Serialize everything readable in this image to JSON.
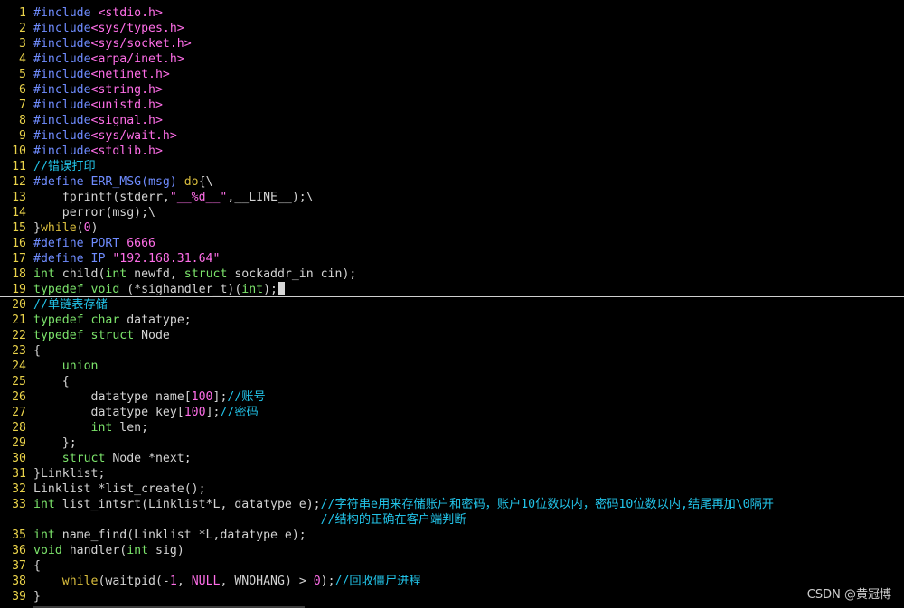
{
  "colors": {
    "keyword": "#d9bd3d",
    "preproc": "#6f8cff",
    "string": "#ff6ee8",
    "number": "#ff6ee8",
    "comment": "#22c3e8",
    "type": "#7ce46b",
    "text": "#d3d3d3",
    "linenum": "#e9d24a"
  },
  "lines": [
    {
      "n": "1",
      "tokens": [
        [
          "preproc",
          "#include "
        ],
        [
          "string",
          "<stdio.h>"
        ]
      ]
    },
    {
      "n": "2",
      "tokens": [
        [
          "preproc",
          "#include"
        ],
        [
          "string",
          "<sys/types.h>"
        ]
      ]
    },
    {
      "n": "3",
      "tokens": [
        [
          "preproc",
          "#include"
        ],
        [
          "string",
          "<sys/socket.h>"
        ]
      ]
    },
    {
      "n": "4",
      "tokens": [
        [
          "preproc",
          "#include"
        ],
        [
          "string",
          "<arpa/inet.h>"
        ]
      ]
    },
    {
      "n": "5",
      "tokens": [
        [
          "preproc",
          "#include"
        ],
        [
          "string",
          "<netinet.h>"
        ]
      ]
    },
    {
      "n": "6",
      "tokens": [
        [
          "preproc",
          "#include"
        ],
        [
          "string",
          "<string.h>"
        ]
      ]
    },
    {
      "n": "7",
      "tokens": [
        [
          "preproc",
          "#include"
        ],
        [
          "string",
          "<unistd.h>"
        ]
      ]
    },
    {
      "n": "8",
      "tokens": [
        [
          "preproc",
          "#include"
        ],
        [
          "string",
          "<signal.h>"
        ]
      ]
    },
    {
      "n": "9",
      "tokens": [
        [
          "preproc",
          "#include"
        ],
        [
          "string",
          "<sys/wait.h>"
        ]
      ]
    },
    {
      "n": "10",
      "tokens": [
        [
          "preproc",
          "#include"
        ],
        [
          "string",
          "<stdlib.h>"
        ]
      ]
    },
    {
      "n": "11",
      "tokens": [
        [
          "comment",
          "//错误打印"
        ]
      ]
    },
    {
      "n": "12",
      "tokens": [
        [
          "preproc",
          "#define ERR_MSG(msg) "
        ],
        [
          "keyword",
          "do"
        ],
        [
          "text",
          "{\\"
        ]
      ]
    },
    {
      "n": "13",
      "tokens": [
        [
          "text",
          "    fprintf(stderr,"
        ],
        [
          "string",
          "\"__%d__\""
        ],
        [
          "text",
          ",__LINE__);\\"
        ]
      ]
    },
    {
      "n": "14",
      "tokens": [
        [
          "text",
          "    perror(msg);\\"
        ]
      ]
    },
    {
      "n": "15",
      "tokens": [
        [
          "text",
          "}"
        ],
        [
          "keyword",
          "while"
        ],
        [
          "text",
          "("
        ],
        [
          "number",
          "0"
        ],
        [
          "text",
          ")"
        ]
      ]
    },
    {
      "n": "16",
      "tokens": [
        [
          "preproc",
          "#define PORT "
        ],
        [
          "number",
          "6666"
        ]
      ]
    },
    {
      "n": "17",
      "tokens": [
        [
          "preproc",
          "#define IP "
        ],
        [
          "string",
          "\"192.168.31.64\""
        ]
      ]
    },
    {
      "n": "18",
      "tokens": [
        [
          "type",
          "int"
        ],
        [
          "text",
          " child("
        ],
        [
          "type",
          "int"
        ],
        [
          "text",
          " newfd, "
        ],
        [
          "type",
          "struct"
        ],
        [
          "text",
          " sockaddr_in cin);"
        ]
      ]
    },
    {
      "n": "19",
      "cursorline": true,
      "tokens": [
        [
          "type",
          "typedef"
        ],
        [
          "text",
          " "
        ],
        [
          "type",
          "void"
        ],
        [
          "text",
          " (*sighandler_t)("
        ],
        [
          "type",
          "int"
        ],
        [
          "text",
          ");"
        ]
      ]
    },
    {
      "n": "20",
      "tokens": [
        [
          "comment",
          "//单链表存储"
        ]
      ]
    },
    {
      "n": "21",
      "tokens": [
        [
          "type",
          "typedef"
        ],
        [
          "text",
          " "
        ],
        [
          "type",
          "char"
        ],
        [
          "text",
          " datatype;"
        ]
      ]
    },
    {
      "n": "22",
      "tokens": [
        [
          "type",
          "typedef"
        ],
        [
          "text",
          " "
        ],
        [
          "type",
          "struct"
        ],
        [
          "text",
          " Node"
        ]
      ]
    },
    {
      "n": "23",
      "tokens": [
        [
          "text",
          "{"
        ]
      ]
    },
    {
      "n": "24",
      "tokens": [
        [
          "text",
          "    "
        ],
        [
          "type",
          "union"
        ]
      ]
    },
    {
      "n": "25",
      "tokens": [
        [
          "text",
          "    {"
        ]
      ]
    },
    {
      "n": "26",
      "tokens": [
        [
          "text",
          "        datatype name["
        ],
        [
          "number",
          "100"
        ],
        [
          "text",
          "];"
        ],
        [
          "comment",
          "//账号"
        ]
      ]
    },
    {
      "n": "27",
      "tokens": [
        [
          "text",
          "        datatype key["
        ],
        [
          "number",
          "100"
        ],
        [
          "text",
          "];"
        ],
        [
          "comment",
          "//密码"
        ]
      ]
    },
    {
      "n": "28",
      "tokens": [
        [
          "text",
          "        "
        ],
        [
          "type",
          "int"
        ],
        [
          "text",
          " len;"
        ]
      ]
    },
    {
      "n": "29",
      "tokens": [
        [
          "text",
          "    };"
        ]
      ]
    },
    {
      "n": "30",
      "tokens": [
        [
          "text",
          "    "
        ],
        [
          "type",
          "struct"
        ],
        [
          "text",
          " Node *next;"
        ]
      ]
    },
    {
      "n": "31",
      "tokens": [
        [
          "text",
          "}Linklist;"
        ]
      ]
    },
    {
      "n": "32",
      "tokens": [
        [
          "text",
          "Linklist *list_create();"
        ]
      ]
    },
    {
      "n": "33",
      "tokens": [
        [
          "type",
          "int"
        ],
        [
          "text",
          " list_intsrt(Linklist*L, datatype e);"
        ],
        [
          "comment",
          "//字符串e用来存储账户和密码，账户10位数以内，密码10位数以内,结尾再加\\0隔开"
        ]
      ]
    },
    {
      "n": "",
      "tokens": [
        [
          "comment",
          "                                        //结构的正确在客户端判断"
        ]
      ]
    },
    {
      "n": "35",
      "tokens": [
        [
          "type",
          "int"
        ],
        [
          "text",
          " name_find(Linklist *L,datatype e);"
        ]
      ]
    },
    {
      "n": "36",
      "tokens": [
        [
          "type",
          "void"
        ],
        [
          "text",
          " handler("
        ],
        [
          "type",
          "int"
        ],
        [
          "text",
          " sig)"
        ]
      ]
    },
    {
      "n": "37",
      "tokens": [
        [
          "text",
          "{"
        ]
      ]
    },
    {
      "n": "38",
      "tokens": [
        [
          "text",
          "    "
        ],
        [
          "keyword",
          "while"
        ],
        [
          "text",
          "(waitpid(-"
        ],
        [
          "number",
          "1"
        ],
        [
          "text",
          ", "
        ],
        [
          "number",
          "NULL"
        ],
        [
          "text",
          ", WNOHANG) > "
        ],
        [
          "number",
          "0"
        ],
        [
          "text",
          ");"
        ],
        [
          "comment",
          "//回收僵尸进程"
        ]
      ]
    },
    {
      "n": "39",
      "tokens": [
        [
          "text",
          "}"
        ]
      ]
    }
  ],
  "watermark": "CSDN @黄冠博"
}
